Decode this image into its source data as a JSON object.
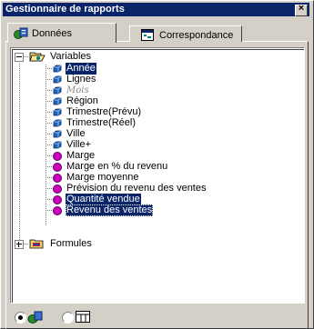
{
  "window": {
    "title": "Gestionnaire de rapports",
    "close_icon": "close-icon"
  },
  "tabs": [
    {
      "label": "Données",
      "icon": "data-provider-icon",
      "active": true
    },
    {
      "label": "Correspondance",
      "icon": "map-icon",
      "active": false
    }
  ],
  "tree": {
    "variables_folder": "Variables",
    "items": [
      {
        "label": "Année",
        "type": "dimension",
        "selected": true
      },
      {
        "label": "Lignes",
        "type": "dimension"
      },
      {
        "label": "Mois",
        "type": "dimension",
        "style": "italic"
      },
      {
        "label": "Région",
        "type": "dimension"
      },
      {
        "label": "Trimestre(Prévu)",
        "type": "dimension"
      },
      {
        "label": "Trimestre(Réel)",
        "type": "dimension"
      },
      {
        "label": "Ville",
        "type": "dimension"
      },
      {
        "label": "Ville+",
        "type": "dimension"
      },
      {
        "label": "Marge",
        "type": "measure"
      },
      {
        "label": "Marge en % du revenu",
        "type": "measure"
      },
      {
        "label": "Marge moyenne",
        "type": "measure"
      },
      {
        "label": "Prévision du revenu des ventes",
        "type": "measure"
      },
      {
        "label": "Quantité vendue",
        "type": "measure",
        "selected": true
      },
      {
        "label": "Revenu des ventes",
        "type": "measure",
        "selected": true,
        "focused": true
      }
    ],
    "formulas_folder": "Formules"
  },
  "bottom": {
    "radio1": {
      "icon": "data-view-icon",
      "checked": true
    },
    "radio2": {
      "icon": "table-view-icon",
      "checked": false
    }
  },
  "colors": {
    "selection": "#0a246a",
    "measure": "#d000c0",
    "dimension": "#1e66b4"
  }
}
